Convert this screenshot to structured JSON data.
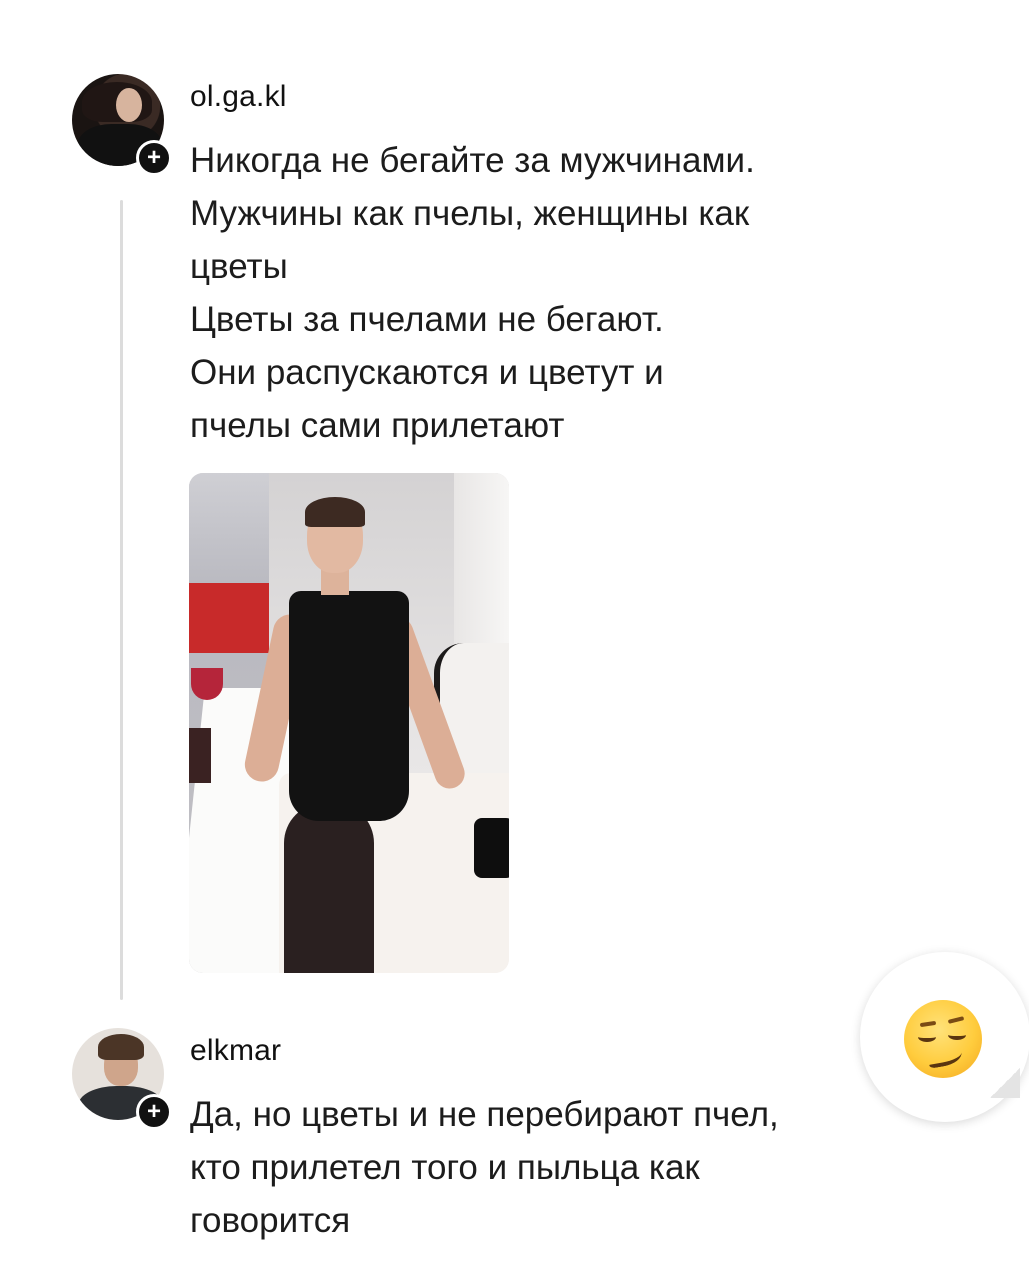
{
  "posts": [
    {
      "username": "ol.ga.kl",
      "avatar_icon": "profile-photo-woman",
      "follow_icon": "plus-icon",
      "text_lines": [
        "Никогда не бегайте за мужчинами.",
        "Мужчины как пчелы, женщины как",
        "цветы",
        "Цветы за пчелами не бегают.",
        "Они распускаются и цветут и",
        "пчелы сами прилетают"
      ],
      "has_photo": true
    },
    {
      "username": "elkmar",
      "avatar_icon": "profile-photo-man",
      "follow_icon": "plus-icon",
      "text_lines": [
        "Да, но цветы и не перебирают пчел,",
        "кто прилетел того и пыльца как",
        "говорится"
      ]
    }
  ],
  "reaction": {
    "emoji": "😏",
    "icon": "smirking-face-emoji",
    "bubble_color": "#ffffff"
  },
  "colors": {
    "background": "#ffffff",
    "text": "#1c1c1c",
    "thread_line": "#dcdcdc",
    "badge": "#111111"
  }
}
